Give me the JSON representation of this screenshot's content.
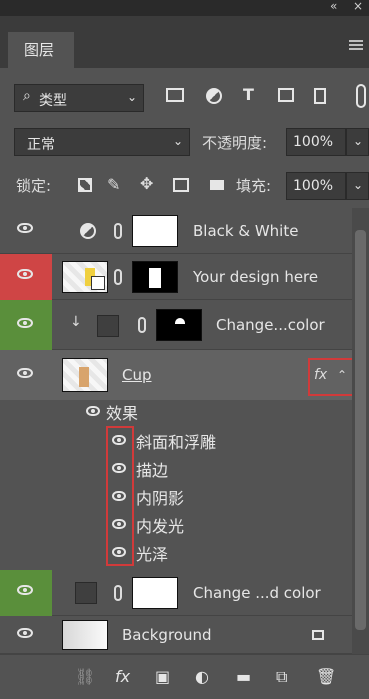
{
  "topbar": {
    "collapse": "«",
    "close": "×"
  },
  "tabs": [
    {
      "label": "图层"
    }
  ],
  "search": {
    "label": "类型"
  },
  "blend": {
    "mode": "正常",
    "opacity_label": "不透明度:",
    "opacity": "100%"
  },
  "lock": {
    "label": "锁定:",
    "fill_label": "填充:",
    "fill": "100%"
  },
  "layers": [
    {
      "name": "Black & White"
    },
    {
      "name": "Your design here"
    },
    {
      "name": "Change...color"
    },
    {
      "name": "Cup",
      "fx": "fx"
    },
    {
      "name": "Change ...d color"
    },
    {
      "name": "Background"
    }
  ],
  "effects": {
    "label": "效果",
    "items": [
      "斜面和浮雕",
      "描边",
      "内阴影",
      "内发光",
      "光泽"
    ]
  },
  "colors": {
    "panel": "#535353",
    "eye_red": "#cf4545",
    "eye_green": "#5a8f3b",
    "highlight": "#d13a3a"
  }
}
